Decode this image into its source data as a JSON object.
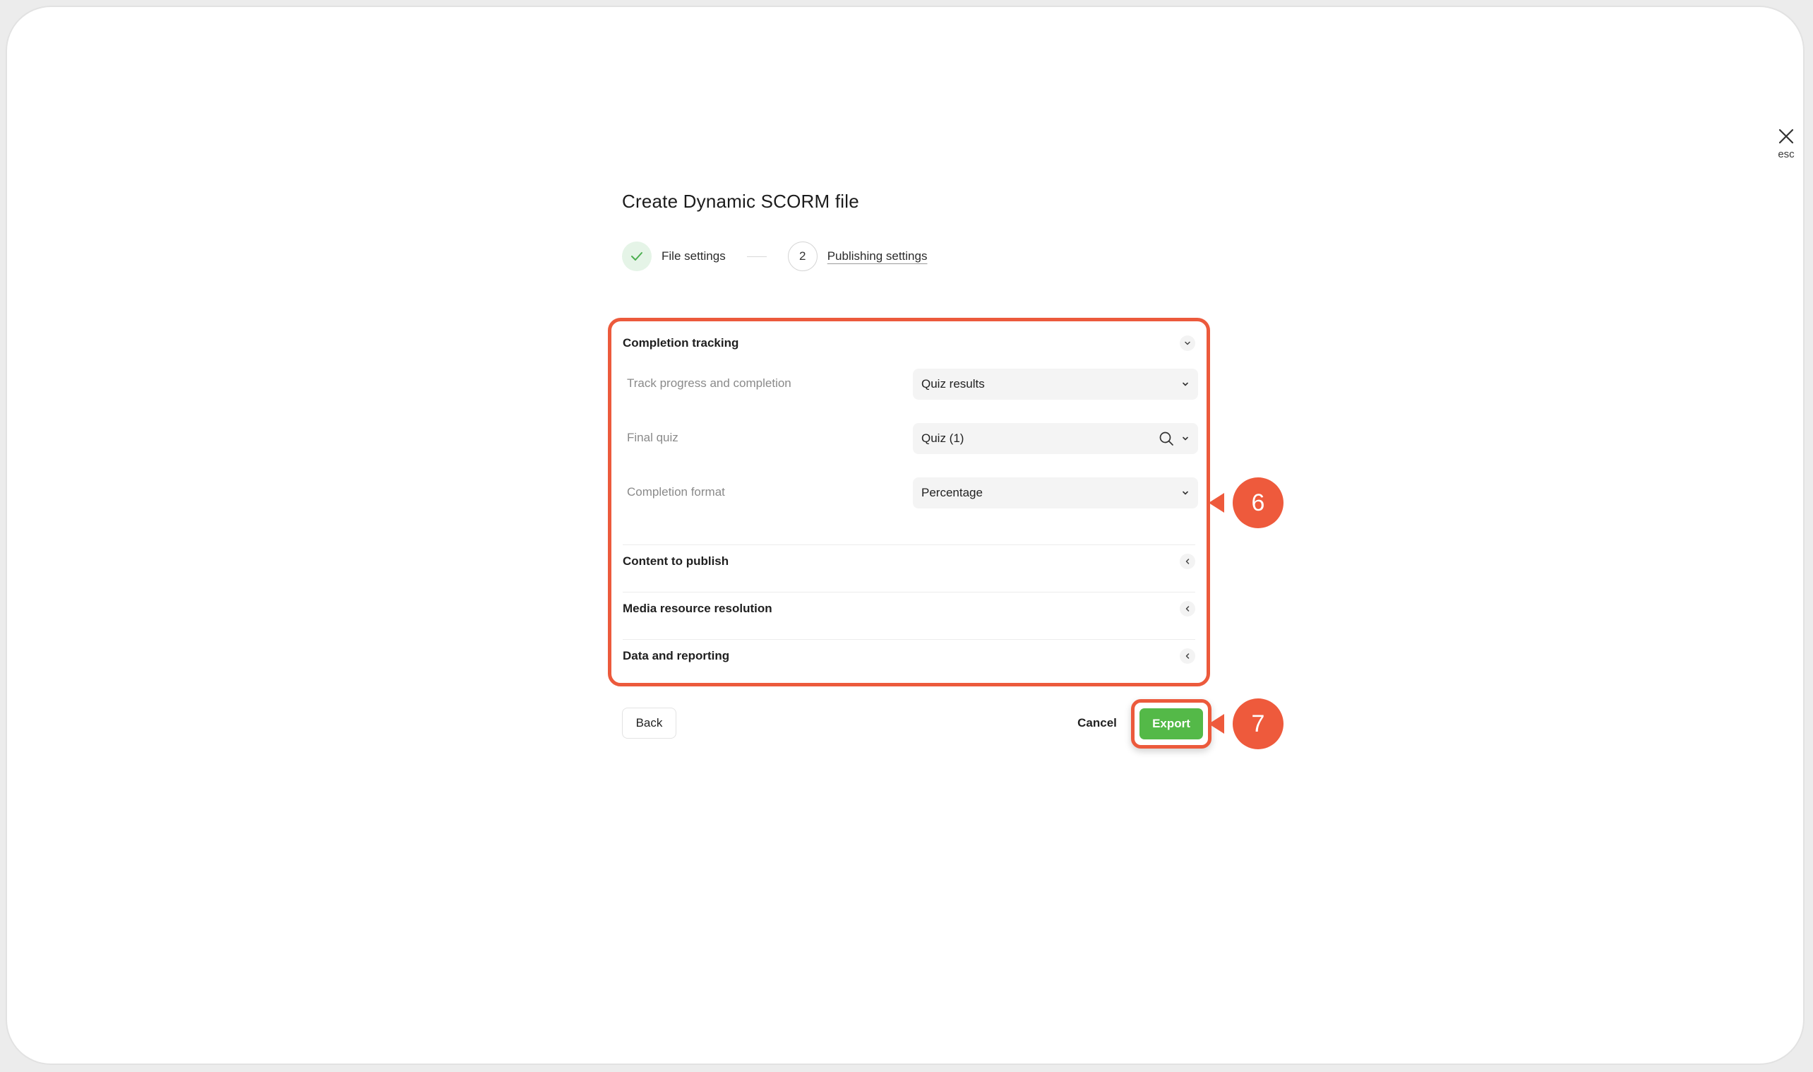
{
  "close": {
    "icon": "close-icon",
    "hint": "esc"
  },
  "dialog": {
    "title": "Create Dynamic SCORM file",
    "steps": [
      {
        "state": "completed",
        "icon": "check-icon",
        "label": "File settings"
      },
      {
        "number": "2",
        "label": "Publishing settings",
        "state": "active"
      }
    ]
  },
  "sections": {
    "completion_tracking": {
      "title": "Completion tracking",
      "expanded": true,
      "rows": [
        {
          "label": "Track progress and completion",
          "value": "Quiz results"
        },
        {
          "label": "Final quiz",
          "value": "Quiz (1)"
        },
        {
          "label": "Completion format",
          "value": "Percentage"
        }
      ]
    },
    "content_to_publish": {
      "title": "Content to publish",
      "expanded": false
    },
    "media_resource_resolution": {
      "title": "Media resource resolution",
      "expanded": false
    },
    "data_and_reporting": {
      "title": "Data and reporting",
      "expanded": false
    }
  },
  "footer": {
    "back_label": "Back",
    "cancel_label": "Cancel",
    "export_label": "Export"
  },
  "callouts": {
    "six": "6",
    "seven": "7"
  },
  "colors": {
    "highlight": "#ec5a3c",
    "export": "#54b948",
    "check": "#4caf50"
  }
}
